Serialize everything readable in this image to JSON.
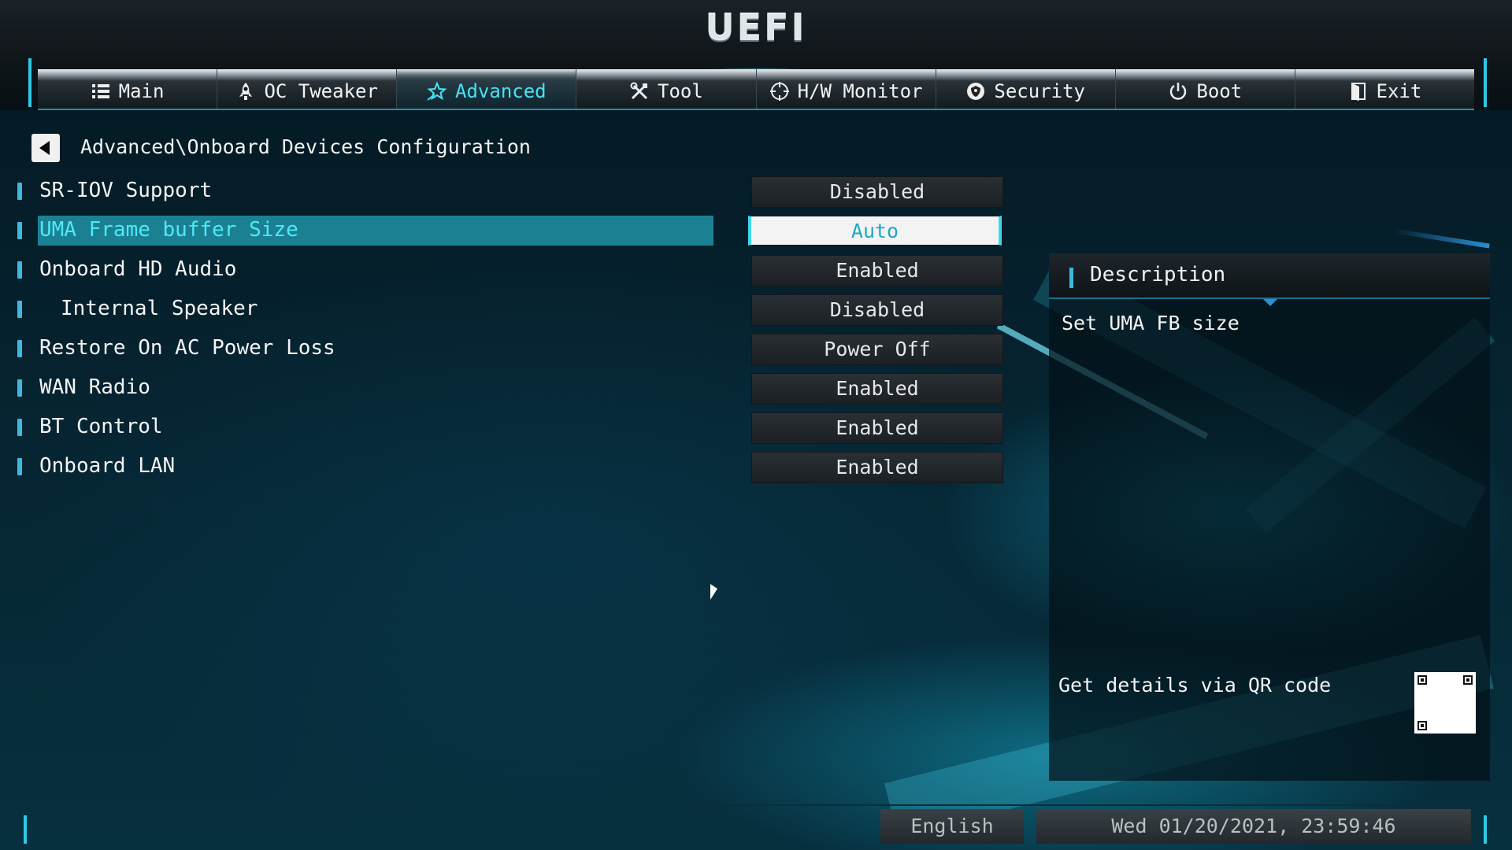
{
  "header": {
    "logo": "UEFI",
    "tabs": [
      {
        "label": "Main",
        "icon": "list-icon"
      },
      {
        "label": "OC Tweaker",
        "icon": "rocket-icon"
      },
      {
        "label": "Advanced",
        "icon": "star-icon",
        "active": true
      },
      {
        "label": "Tool",
        "icon": "tools-icon"
      },
      {
        "label": "H/W Monitor",
        "icon": "crosshair-icon"
      },
      {
        "label": "Security",
        "icon": "shield-icon"
      },
      {
        "label": "Boot",
        "icon": "power-icon"
      },
      {
        "label": "Exit",
        "icon": "exit-door-icon"
      }
    ]
  },
  "breadcrumb": "Advanced\\Onboard Devices Configuration",
  "settings": [
    {
      "label": "SR-IOV Support",
      "value": "Disabled"
    },
    {
      "label": "UMA Frame buffer Size",
      "value": "Auto",
      "selected": true
    },
    {
      "label": "Onboard HD Audio",
      "value": "Enabled"
    },
    {
      "label": "Internal Speaker",
      "value": "Disabled",
      "indent": true
    },
    {
      "label": "Restore On AC Power Loss",
      "value": "Power Off"
    },
    {
      "label": "WAN Radio",
      "value": "Enabled"
    },
    {
      "label": "BT Control",
      "value": "Enabled"
    },
    {
      "label": "Onboard LAN",
      "value": "Enabled"
    }
  ],
  "description": {
    "title": "Description",
    "text": "Set UMA FB size",
    "qr_text": "Get details via QR code"
  },
  "footer": {
    "language": "English",
    "datetime": "Wed 01/20/2021, 23:59:46"
  },
  "colors": {
    "accent": "#46e3f4",
    "selection": "#1b8192",
    "marker": "#3fb8dc"
  }
}
